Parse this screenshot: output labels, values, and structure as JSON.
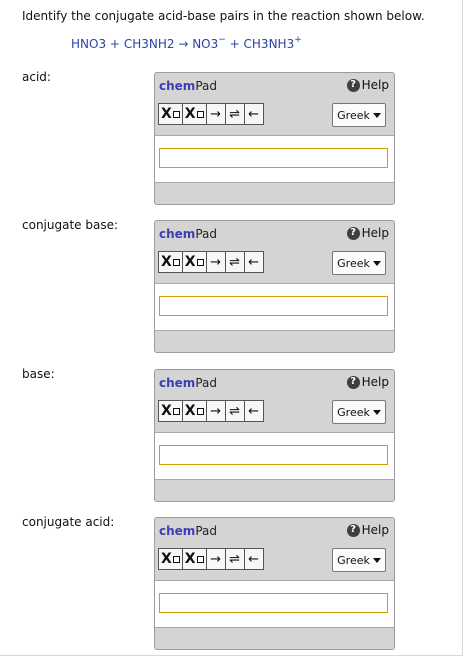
{
  "question": "Identify the conjugate acid-base pairs in the reaction shown below.",
  "equation": {
    "reactant1": "HNO3",
    "plus1": "+",
    "reactant2": "CH3NH2",
    "arrow": "→",
    "product1": "NO3",
    "product1_charge": "−",
    "plus2": "+",
    "product2": "CH3NH3",
    "product2_charge": "+"
  },
  "fields": [
    {
      "label": "acid:"
    },
    {
      "label": "conjugate base:"
    },
    {
      "label": "base:"
    },
    {
      "label": "conjugate acid:"
    }
  ],
  "chempad": {
    "title_chem": "chem",
    "title_pad": "Pad",
    "help_label": "Help",
    "help_icon": "question-circle-icon",
    "subscript_label": "X",
    "superscript_label": "X",
    "arrow_right": "→",
    "arrow_equilibrium": "⇌",
    "arrow_left": "←",
    "greek_label": "Greek",
    "input_value": ""
  },
  "colors": {
    "equation": "#2b43a8",
    "chempad_brand": "#3a3fb6",
    "input_border": "#d0a000"
  }
}
